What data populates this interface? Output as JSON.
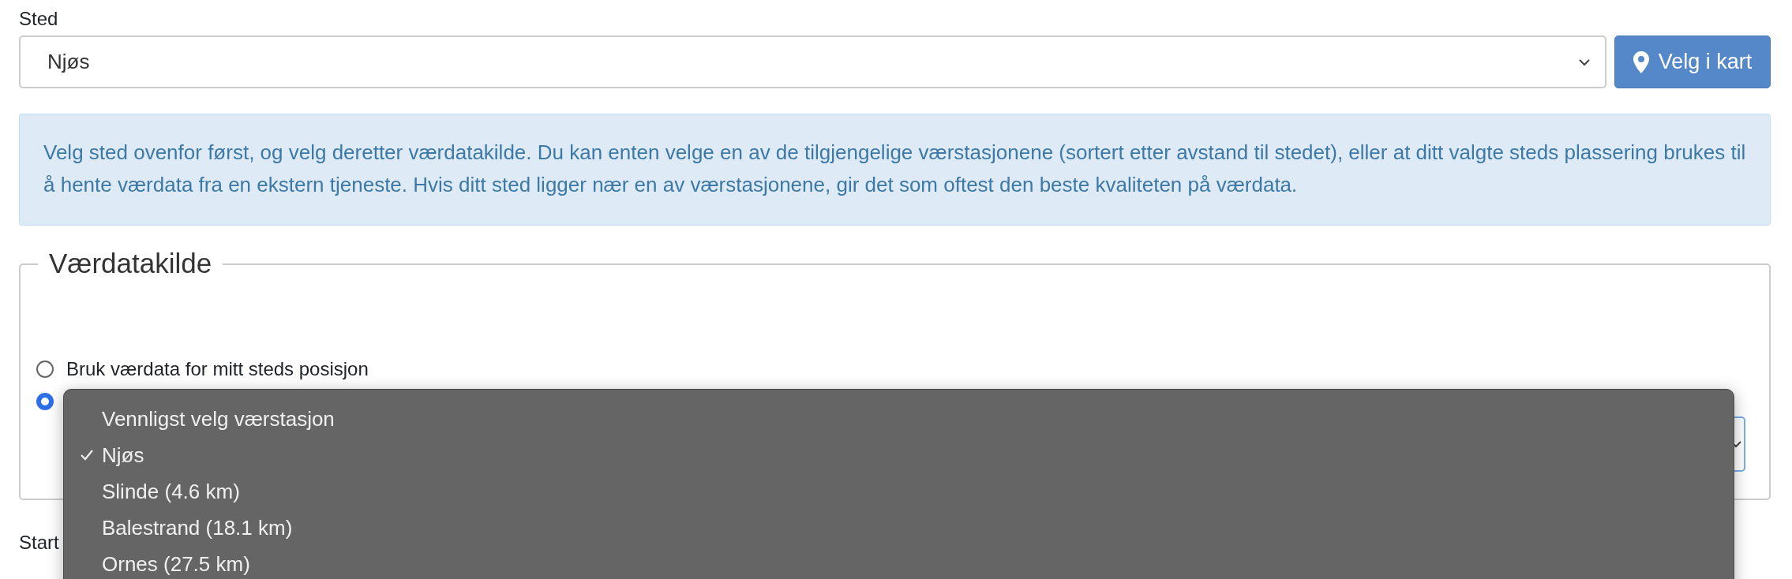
{
  "location": {
    "label": "Sted",
    "value": "Njøs",
    "map_button": "Velg i kart"
  },
  "info": "Velg sted ovenfor først, og velg deretter værdatakilde. Du kan enten velge en av de tilgjengelige værstasjonene (sortert etter avstand til stedet), eller at ditt valgte steds plassering brukes til å hente værdata fra en ekstern tjeneste. Hvis ditt sted ligger nær en av værstasjonene, gir det som oftest den beste kvaliteten på værdata.",
  "weather_source": {
    "legend": "Værdatakilde",
    "options": [
      {
        "kind": "position",
        "label": "Bruk værdata for mitt steds posisjon",
        "selected": false
      },
      {
        "kind": "station",
        "selected": true
      }
    ]
  },
  "station_dropdown": {
    "items": [
      {
        "label": "Vennligst velg værstasjon",
        "selected": false
      },
      {
        "label": "Njøs",
        "selected": true
      },
      {
        "label": "Slinde (4.6 km)",
        "selected": false
      },
      {
        "label": "Balestrand (18.1 km)",
        "selected": false
      },
      {
        "label": "Ornes (27.5 km)",
        "selected": false
      }
    ]
  },
  "next_label": "Start"
}
